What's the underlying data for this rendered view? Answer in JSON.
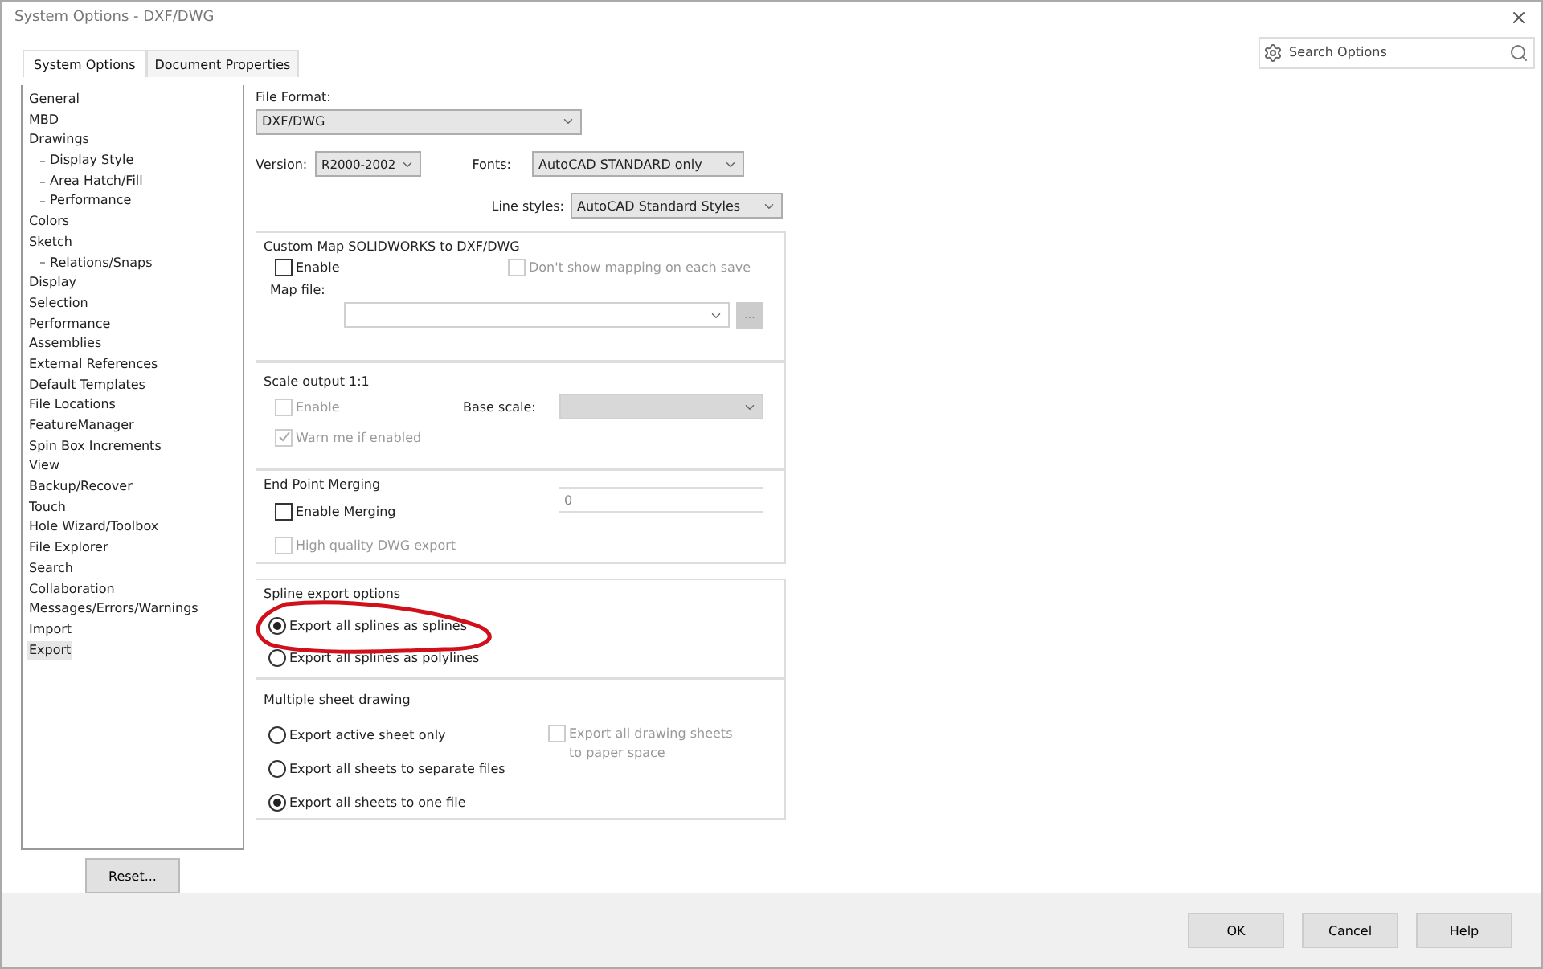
{
  "window": {
    "title": "System Options - DXF/DWG"
  },
  "tabs": [
    {
      "label": "System Options",
      "selected": true
    },
    {
      "label": "Document Properties",
      "selected": false
    }
  ],
  "search": {
    "placeholder": "Search Options"
  },
  "sidebar": {
    "items": [
      {
        "label": "General",
        "selected": false
      },
      {
        "label": "MBD",
        "selected": false
      },
      {
        "label": "Drawings",
        "selected": false,
        "children": [
          {
            "label": "Display Style",
            "selected": false
          },
          {
            "label": "Area Hatch/Fill",
            "selected": false
          },
          {
            "label": "Performance",
            "selected": false
          }
        ]
      },
      {
        "label": "Colors",
        "selected": false
      },
      {
        "label": "Sketch",
        "selected": false,
        "children": [
          {
            "label": "Relations/Snaps",
            "selected": false
          }
        ]
      },
      {
        "label": "Display",
        "selected": false
      },
      {
        "label": "Selection",
        "selected": false
      },
      {
        "label": "Performance",
        "selected": false
      },
      {
        "label": "Assemblies",
        "selected": false
      },
      {
        "label": "External References",
        "selected": false
      },
      {
        "label": "Default Templates",
        "selected": false
      },
      {
        "label": "File Locations",
        "selected": false
      },
      {
        "label": "FeatureManager",
        "selected": false
      },
      {
        "label": "Spin Box Increments",
        "selected": false
      },
      {
        "label": "View",
        "selected": false
      },
      {
        "label": "Backup/Recover",
        "selected": false
      },
      {
        "label": "Touch",
        "selected": false
      },
      {
        "label": "Hole Wizard/Toolbox",
        "selected": false
      },
      {
        "label": "File Explorer",
        "selected": false
      },
      {
        "label": "Search",
        "selected": false
      },
      {
        "label": "Collaboration",
        "selected": false
      },
      {
        "label": "Messages/Errors/Warnings",
        "selected": false
      },
      {
        "label": "Import",
        "selected": false
      },
      {
        "label": "Export",
        "selected": true
      }
    ]
  },
  "file_format": {
    "label": "File Format:",
    "value": "DXF/DWG"
  },
  "version": {
    "label": "Version:",
    "value": "R2000-2002"
  },
  "fonts": {
    "label": "Fonts:",
    "value": "AutoCAD STANDARD only"
  },
  "line_styles": {
    "label": "Line styles:",
    "value": "AutoCAD Standard Styles"
  },
  "custom_map": {
    "title": "Custom Map SOLIDWORKS to DXF/DWG",
    "enable": {
      "label": "Enable",
      "checked": false,
      "disabled": false
    },
    "dont_show": {
      "label": "Don't show mapping on each save",
      "checked": false,
      "disabled": true
    },
    "map_file": {
      "label": "Map file:",
      "browse": "...",
      "disabled": true
    }
  },
  "scale_output": {
    "title": "Scale output 1:1",
    "enable": {
      "label": "Enable",
      "checked": false,
      "disabled": true
    },
    "warn": {
      "label": "Warn me if enabled",
      "checked": true,
      "disabled": true
    },
    "base_scale": {
      "label": "Base scale:",
      "disabled": true
    }
  },
  "end_point_merging": {
    "title": "End Point Merging",
    "enable": {
      "label": "Enable Merging",
      "checked": false,
      "disabled": false
    },
    "tolerance": {
      "value": "0",
      "disabled": true
    },
    "high_quality": {
      "label": "High quality DWG export",
      "checked": false,
      "disabled": true
    }
  },
  "spline_export": {
    "title": "Spline export options",
    "options": [
      {
        "label": "Export all splines as splines",
        "selected": true
      },
      {
        "label": "Export all splines as polylines",
        "selected": false
      }
    ]
  },
  "multiple_sheet": {
    "title": "Multiple sheet drawing",
    "options": [
      {
        "label": "Export active sheet only",
        "selected": false
      },
      {
        "label": "Export all sheets to separate files",
        "selected": false
      },
      {
        "label": "Export all sheets to one file",
        "selected": true
      }
    ],
    "paper_space": {
      "label": "Export all drawing sheets to paper space",
      "checked": false,
      "disabled": true
    }
  },
  "reset_button": "Reset...",
  "buttons": [
    "OK",
    "Cancel",
    "Help"
  ]
}
